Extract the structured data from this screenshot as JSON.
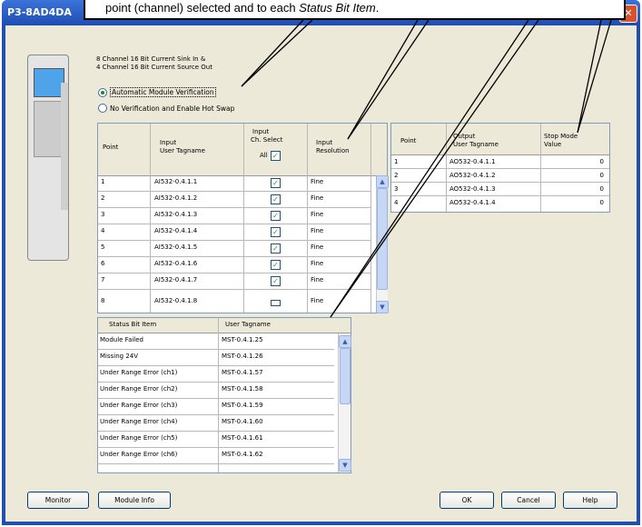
{
  "window": {
    "title": "P3-8AD4DA"
  },
  "callout": {
    "text_plain": "point (channel) selected and to each ",
    "text_italic": "Status Bit Item",
    "text_end": "."
  },
  "module": {
    "description_line1": "8 Channel 16 Bit Current Sink In &",
    "description_line2": "4 Channel 16 Bit Current Source Out"
  },
  "verification": {
    "options": [
      {
        "label": "Automatic Module Verification",
        "selected": true
      },
      {
        "label": "No Verification and Enable Hot Swap",
        "selected": false
      }
    ]
  },
  "input_table": {
    "headers": {
      "point": "Point",
      "tagname_1": "Input",
      "tagname_2": "User Tagname",
      "select_1": "Input",
      "select_2": "Ch. Select",
      "select_all": "All",
      "res_1": "Input",
      "res_2": "Resolution"
    },
    "rows": [
      {
        "point": "1",
        "tag": "AI532-0.4.1.1",
        "res": "Fine"
      },
      {
        "point": "2",
        "tag": "AI532-0.4.1.2",
        "res": "Fine"
      },
      {
        "point": "3",
        "tag": "AI532-0.4.1.3",
        "res": "Fine"
      },
      {
        "point": "4",
        "tag": "AI532-0.4.1.4",
        "res": "Fine"
      },
      {
        "point": "5",
        "tag": "AI532-0.4.1.5",
        "res": "Fine"
      },
      {
        "point": "6",
        "tag": "AI532-0.4.1.6",
        "res": "Fine"
      },
      {
        "point": "7",
        "tag": "AI532-0.4.1.7",
        "res": "Fine"
      },
      {
        "point": "8",
        "tag": "AI532-0.4.1.8",
        "res": "Fine"
      }
    ]
  },
  "output_table": {
    "headers": {
      "point": "Point",
      "tag_1": "Output",
      "tag_2": "User Tagname",
      "stop_1": "Stop Mode",
      "stop_2": "Value"
    },
    "rows": [
      {
        "point": "1",
        "tag": "AO532-0.4.1.1",
        "value": "0"
      },
      {
        "point": "2",
        "tag": "AO532-0.4.1.2",
        "value": "0"
      },
      {
        "point": "3",
        "tag": "AO532-0.4.1.3",
        "value": "0"
      },
      {
        "point": "4",
        "tag": "AO532-0.4.1.4",
        "value": "0"
      }
    ]
  },
  "status_table": {
    "headers": {
      "item": "Status Bit Item",
      "tag": "User Tagname"
    },
    "rows": [
      {
        "item": "Module Failed",
        "tag": "MST-0.4.1.25"
      },
      {
        "item": "Missing 24V",
        "tag": "MST-0.4.1.26"
      },
      {
        "item": "Under Range Error (ch1)",
        "tag": "MST-0.4.1.57"
      },
      {
        "item": "Under Range Error (ch2)",
        "tag": "MST-0.4.1.58"
      },
      {
        "item": "Under Range Error (ch3)",
        "tag": "MST-0.4.1.59"
      },
      {
        "item": "Under Range Error (ch4)",
        "tag": "MST-0.4.1.60"
      },
      {
        "item": "Under Range Error (ch5)",
        "tag": "MST-0.4.1.61"
      },
      {
        "item": "Under Range Error (ch6)",
        "tag": "MST-0.4.1.62"
      }
    ]
  },
  "buttons": {
    "monitor": "Monitor",
    "module_info": "Module Info",
    "ok": "OK",
    "cancel": "Cancel",
    "help": "Help"
  },
  "icons": {
    "close": "close-icon",
    "check": "checkmark-icon",
    "scroll_up": "scroll-up-icon",
    "scroll_down": "scroll-down-icon"
  },
  "colors": {
    "title_bar": "#2a5fc7",
    "check": "#21a121",
    "radio_selected": "#1b8a1b"
  }
}
